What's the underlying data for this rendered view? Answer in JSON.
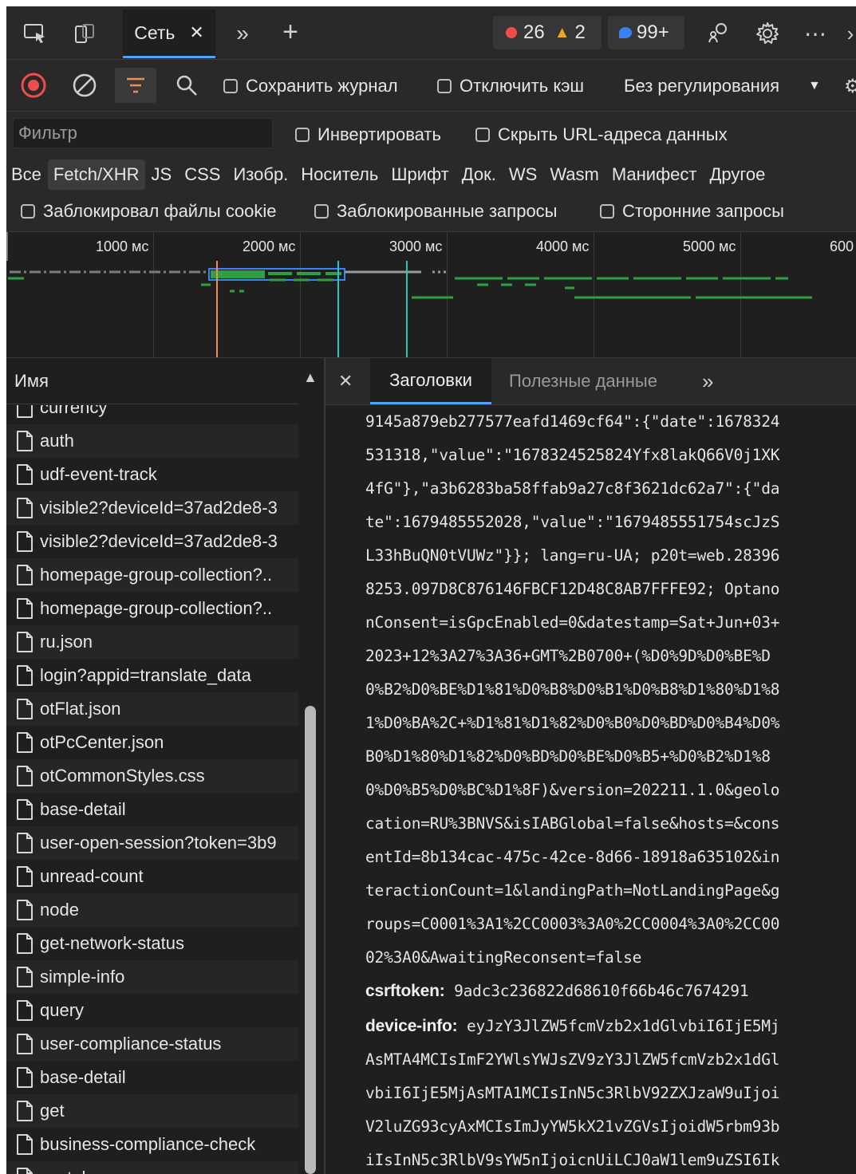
{
  "toolbar": {
    "tab_label": "Сеть",
    "errors": "26",
    "warnings": "2",
    "messages": "99+"
  },
  "controls": {
    "preserve_log": "Сохранить журнал",
    "disable_cache": "Отключить кэш",
    "throttling": "Без регулирования"
  },
  "filter": {
    "placeholder": "Фильтр",
    "invert": "Инвертировать",
    "hide_data_urls": "Скрыть URL-адреса данных",
    "types": [
      "Все",
      "Fetch/XHR",
      "JS",
      "CSS",
      "Изобр.",
      "Носитель",
      "Шрифт",
      "Док.",
      "WS",
      "Wasm",
      "Манифест",
      "Другое"
    ],
    "selected_type": "Fetch/XHR",
    "blocked_cookies": "Заблокировал файлы cookie",
    "blocked_requests": "Заблокированные запросы",
    "third_party": "Сторонние запросы"
  },
  "timeline": {
    "ticks": [
      "1000 мс",
      "2000 мс",
      "3000 мс",
      "4000 мс",
      "5000 мс",
      "600"
    ]
  },
  "requests": {
    "column_name": "Имя",
    "items": [
      "currency",
      "auth",
      "udf-event-track",
      "visible2?deviceId=37ad2de8-3",
      "visible2?deviceId=37ad2de8-3",
      "homepage-group-collection?..",
      "homepage-group-collection?..",
      "ru.json",
      "login?appid=translate_data",
      "otFlat.json",
      "otPcCenter.json",
      "otCommonStyles.css",
      "base-detail",
      "user-open-session?token=3b9",
      "unread-count",
      "node",
      "get-network-status",
      "simple-info",
      "query",
      "user-compliance-status",
      "base-detail",
      "get",
      "business-compliance-check",
      "ws-token"
    ]
  },
  "details": {
    "tabs": [
      "Заголовки",
      "Полезные данные"
    ],
    "active_tab": "Заголовки",
    "cookie_lines": [
      "9145a879eb277577eafd1469cf64\":{\"date\":1678324",
      "531318,\"value\":\"1678324525824Yfx8lakQ66V0j1XK",
      "4fG\"},\"a3b6283ba58ffab9a27c8f3621dc62a7\":{\"da",
      "te\":1679485552028,\"value\":\"1679485551754scJzS",
      "L33hBuQN0tVUWz\"}}; lang=ru-UA; p20t=web.28396",
      "8253.097D8C876146FBCF12D48C8AB7FFFE92; Optano",
      "nConsent=isGpcEnabled=0&datestamp=Sat+Jun+03+",
      "2023+12%3A27%3A36+GMT%2B0700+(%D0%9D%D0%BE%D",
      "0%B2%D0%BE%D1%81%D0%B8%D0%B1%D0%B8%D1%80%D1%8",
      "1%D0%BA%2C+%D1%81%D1%82%D0%B0%D0%BD%D0%B4%D0%",
      "B0%D1%80%D1%82%D0%BD%D0%BE%D0%B5+%D0%B2%D1%8",
      "0%D0%B5%D0%BC%D1%8F)&version=202211.1.0&geolo",
      "cation=RU%3BNVS&isIABGlobal=false&hosts=&cons",
      "entId=8b134cac-475c-42ce-8d66-18918a635102&in",
      "teractionCount=1&landingPath=NotLandingPage&g",
      "roups=C0001%3A1%2CC0003%3A0%2CC0004%3A0%2CC00",
      "02%3A0&AwaitingReconsent=false"
    ],
    "csrf_name": "csrftoken:",
    "csrf_value": "9adc3c236822d68610f66b46c7674291",
    "device_name": "device-info:",
    "device_lines": [
      "eyJzY3JlZW5fcmVzb2x1dGlvbiI6IjE5Mj",
      "AsMTA4MCIsImF2YWlsYWJsZV9zY3JlZW5fcmVzb2x1dGl",
      "vbiI6IjE5MjAsMTA1MCIsInN5c3RlbV92ZXJzaW9uIjoi",
      "V2luZG93cyAxMCIsImJyYW5kX21vZGVsIjoidW5rbm93b",
      "iIsInN5c3RlbV9sYW5nIjoicnUiLCJ0aW1lem9uZSI6Ik"
    ]
  },
  "colors": {
    "accent": "#4fa3ff",
    "error": "#f14c4c",
    "warning": "#f5a623",
    "stop": "#f14c4c",
    "filter_active": "#f28b54",
    "timeline_green": "#2ea043",
    "timeline_blue": "#3b82f6"
  }
}
